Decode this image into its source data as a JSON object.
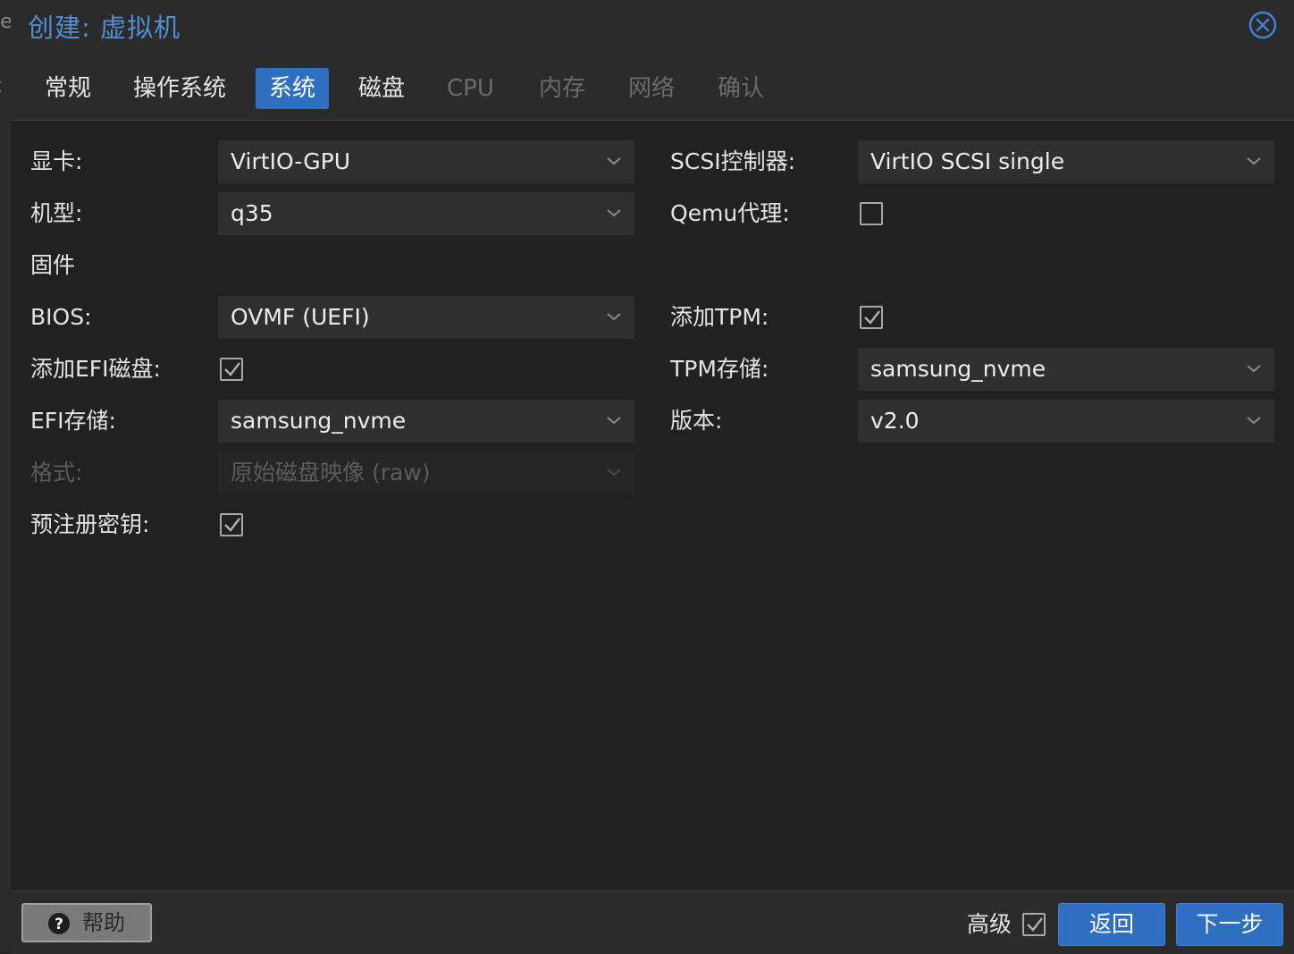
{
  "window": {
    "title": "创建: 虚拟机"
  },
  "tabs": [
    {
      "label": "常规",
      "state": "normal"
    },
    {
      "label": "操作系统",
      "state": "normal"
    },
    {
      "label": "系统",
      "state": "active"
    },
    {
      "label": "磁盘",
      "state": "normal"
    },
    {
      "label": "CPU",
      "state": "disabled"
    },
    {
      "label": "内存",
      "state": "disabled"
    },
    {
      "label": "网络",
      "state": "disabled"
    },
    {
      "label": "确认",
      "state": "disabled"
    }
  ],
  "left": {
    "graphics_label": "显卡:",
    "graphics_value": "VirtIO-GPU",
    "machine_label": "机型:",
    "machine_value": "q35",
    "firmware_heading": "固件",
    "bios_label": "BIOS:",
    "bios_value": "OVMF (UEFI)",
    "add_efi_label": "添加EFI磁盘:",
    "add_efi_checked": true,
    "efi_storage_label": "EFI存储:",
    "efi_storage_value": "samsung_nvme",
    "format_label": "格式:",
    "format_value": "原始磁盘映像 (raw)",
    "prekeys_label": "预注册密钥:",
    "prekeys_checked": true
  },
  "right": {
    "scsi_label": "SCSI控制器:",
    "scsi_value": "VirtIO SCSI single",
    "qemu_agent_label": "Qemu代理:",
    "qemu_agent_checked": false,
    "add_tpm_label": "添加TPM:",
    "add_tpm_checked": true,
    "tpm_storage_label": "TPM存储:",
    "tpm_storage_value": "samsung_nvme",
    "version_label": "版本:",
    "version_value": "v2.0"
  },
  "footer": {
    "help_label": "帮助",
    "advanced_label": "高级",
    "advanced_checked": true,
    "back_label": "返回",
    "next_label": "下一步"
  },
  "colors": {
    "accent": "#2f6fc1",
    "title": "#4f8fd6",
    "background": "#212121"
  }
}
